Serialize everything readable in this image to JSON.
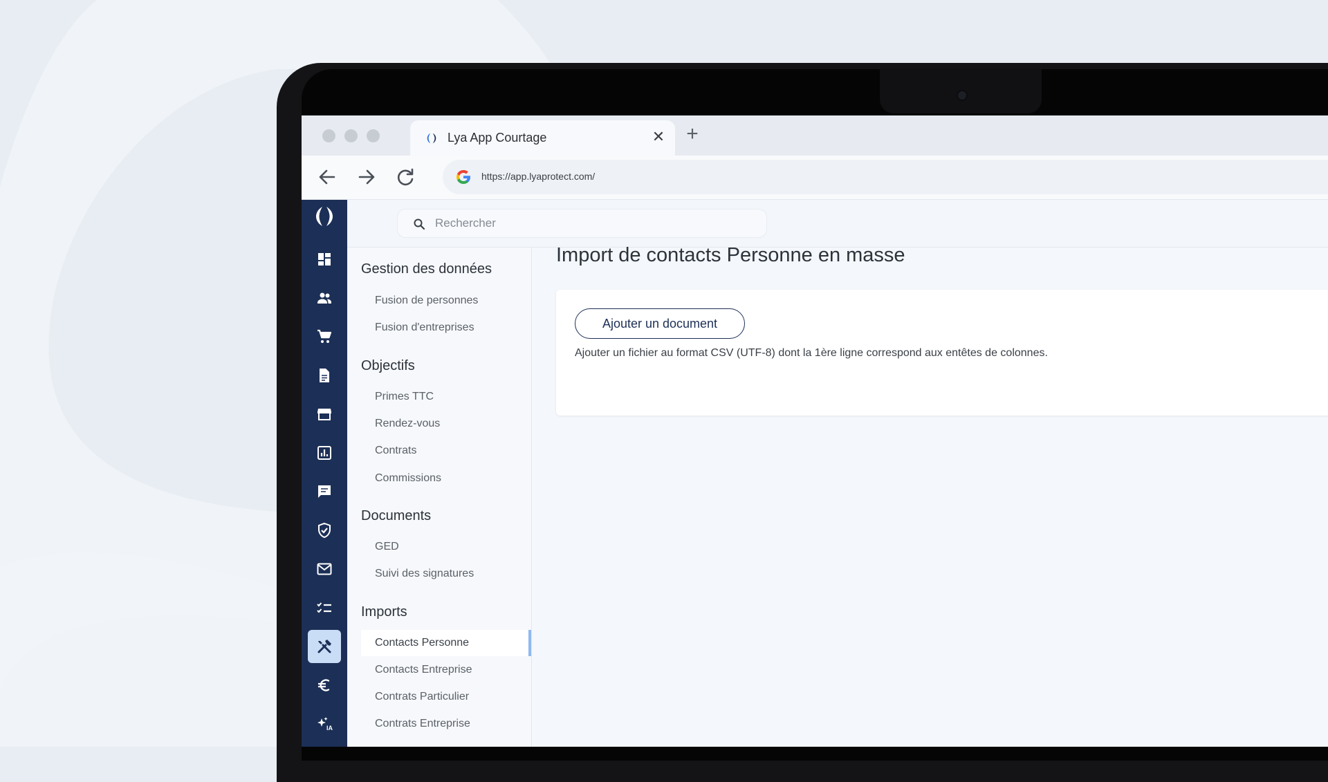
{
  "browser": {
    "tab_title": "Lya App Courtage",
    "url": "https://app.lyaprotect.com/"
  },
  "search": {
    "placeholder": "Rechercher"
  },
  "rail": {
    "icons": [
      "dashboard-icon",
      "people-icon",
      "cart-icon",
      "document-icon",
      "store-icon",
      "bar-chart-icon",
      "chat-icon",
      "shield-check-icon",
      "mail-icon",
      "checklist-icon",
      "tools-icon",
      "euro-icon",
      "sparkle-ia-icon"
    ],
    "active": "tools-icon",
    "ia_label": "IA"
  },
  "submenu": {
    "sections": [
      {
        "title": "Gestion des données",
        "items": [
          "Fusion de personnes",
          "Fusion d'entreprises"
        ]
      },
      {
        "title": "Objectifs",
        "items": [
          "Primes TTC",
          "Rendez-vous",
          "Contrats",
          "Commissions"
        ]
      },
      {
        "title": "Documents",
        "items": [
          "GED",
          "Suivi des signatures"
        ]
      },
      {
        "title": "Imports",
        "items": [
          "Contacts Personne",
          "Contacts Entreprise",
          "Contrats Particulier",
          "Contrats Entreprise"
        ]
      }
    ],
    "active_item": "Contacts Personne"
  },
  "main": {
    "title": "Import de contacts Personne en masse",
    "add_button": "Ajouter un document",
    "help_text": "Ajouter un fichier au format CSV (UTF-8) dont la 1ère ligne correspond aux entêtes de colonnes."
  },
  "colors": {
    "rail_bg": "#1c2f56",
    "active_rail": "#c9ddf6",
    "accent": "#1d2f56"
  }
}
